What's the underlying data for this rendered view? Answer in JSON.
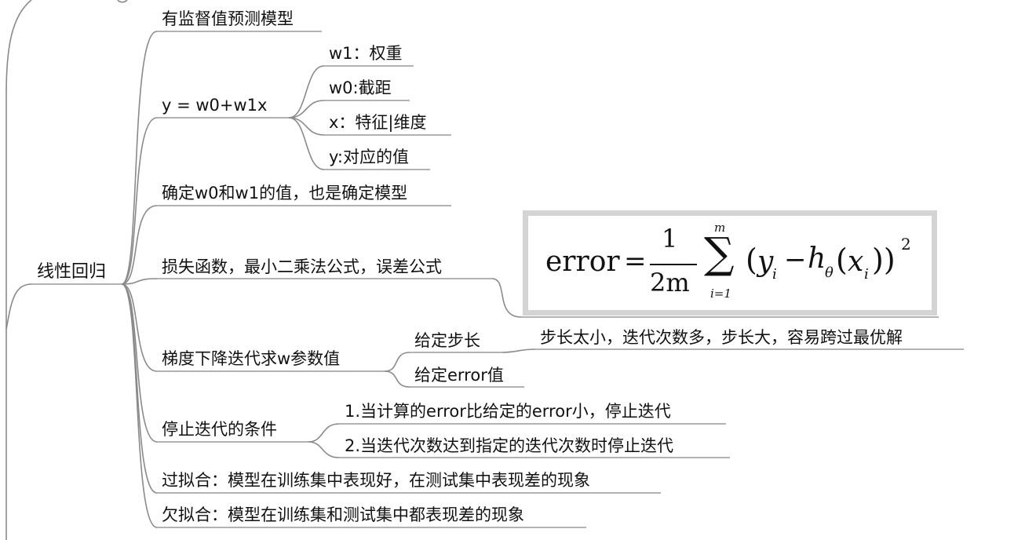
{
  "root": {
    "label": "线性回归"
  },
  "branches": [
    {
      "id": "b1",
      "label": "有监督值预测模型"
    },
    {
      "id": "b2",
      "label": "y = w0+w1x",
      "children": [
        "w1：权重",
        "w0:截距",
        "x：特征|维度",
        "y:对应的值"
      ]
    },
    {
      "id": "b3",
      "label": "确定w0和w1的值，也是确定模型"
    },
    {
      "id": "b4",
      "label": "损失函数，最小二乘法公式，误差公式"
    },
    {
      "id": "b5",
      "label": "梯度下降迭代求w参数值",
      "children": [
        {
          "label": "给定步长",
          "note": "步长太小，迭代次数多，步长大，容易跨过最优解"
        },
        {
          "label": "给定error值"
        }
      ]
    },
    {
      "id": "b6",
      "label": "停止迭代的条件",
      "children": [
        "1.当计算的error比给定的error小，停止迭代",
        "2.当迭代次数达到指定的迭代次数时停止迭代"
      ]
    },
    {
      "id": "b7",
      "label": "过拟合：模型在训练集中表现好，在测试集中表现差的现象"
    },
    {
      "id": "b8",
      "label": "欠拟合：模型在训练集和测试集中都表现差的现象"
    }
  ],
  "formula": {
    "lhs": "error",
    "equals": "=",
    "numerator": "1",
    "denominator": "2m",
    "sum_upper": "m",
    "sum_lower": "i=1",
    "sigma": "∑",
    "open": "(",
    "y": "y",
    "y_sub": "i",
    "minus": "−",
    "h": "h",
    "h_sub": "θ",
    "x_open": "(",
    "x": "x",
    "x_sub": "i",
    "close": "))",
    "power": "2"
  }
}
